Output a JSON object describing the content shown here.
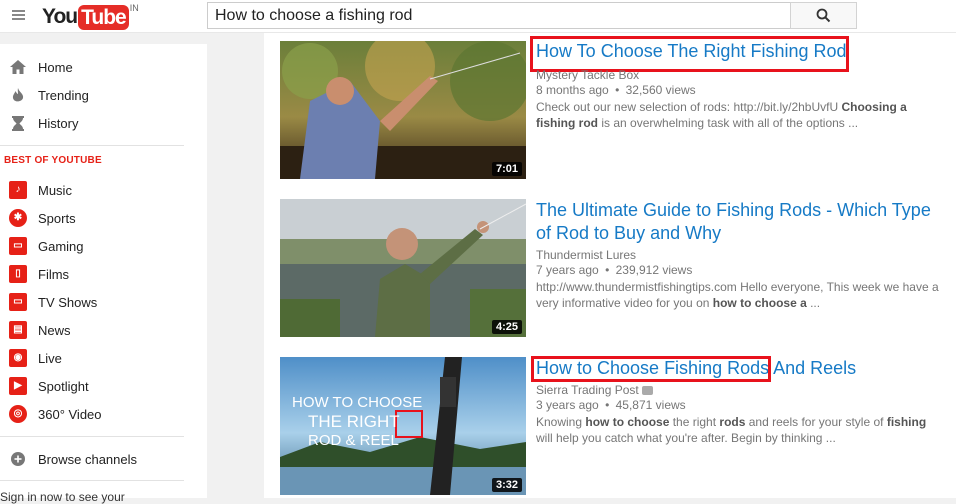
{
  "header": {
    "logo_you": "You",
    "logo_tube": "Tube",
    "logo_country": "IN",
    "search_value": "How to choose a fishing rod",
    "search_icon": "search-icon",
    "menu_icon": "hamburger-icon"
  },
  "sidebar": {
    "main_items": [
      {
        "label": "Home",
        "icon": "home-icon"
      },
      {
        "label": "Trending",
        "icon": "flame-icon"
      },
      {
        "label": "History",
        "icon": "hourglass-icon"
      }
    ],
    "best_title": "BEST OF YOUTUBE",
    "best_items": [
      {
        "label": "Music",
        "icon": "music-icon"
      },
      {
        "label": "Sports",
        "icon": "sports-icon"
      },
      {
        "label": "Gaming",
        "icon": "gaming-icon"
      },
      {
        "label": "Films",
        "icon": "film-icon"
      },
      {
        "label": "TV Shows",
        "icon": "tv-icon"
      },
      {
        "label": "News",
        "icon": "news-icon"
      },
      {
        "label": "Live",
        "icon": "live-icon"
      },
      {
        "label": "Spotlight",
        "icon": "spotlight-icon"
      },
      {
        "label": "360° Video",
        "icon": "360-video-icon"
      }
    ],
    "browse_label": "Browse channels",
    "signin_partial": "Sign in now to see your"
  },
  "results": [
    {
      "title": "How To Choose The Right Fishing Rod",
      "channel": "Mystery Tackle Box",
      "age": "8 months ago",
      "views": "32,560 views",
      "desc_plain": "Check out our new selection of rods: http://bit.ly/2hbUvfU ",
      "desc_bold": "Choosing a fishing rod",
      "desc_rest": " is an overwhelming task with all of the options ...",
      "duration": "7:01"
    },
    {
      "title_line1": "The Ultimate Guide to Fishing Rods - Which Type",
      "title_line2": "of Rod to Buy and Why",
      "channel": "Thundermist Lures",
      "age": "7 years ago",
      "views": "239,912 views",
      "desc_plain": "http://www.thundermistfishingtips.com Hello everyone, This week we have a very informative video for you on ",
      "desc_bold": "how to choose a",
      "desc_rest": " ...",
      "duration": "4:25"
    },
    {
      "title_highlight": "How to Choose Fishing Rods",
      "title_rest": " And Reels",
      "channel": "Sierra Trading Post",
      "age": "3 years ago",
      "views": "45,871 views",
      "desc_a": "Knowing ",
      "desc_b1": "how to choose",
      "desc_c": " the right ",
      "desc_b2": "rods",
      "desc_d": " and reels for your style of ",
      "desc_b3": "fishing",
      "desc_e": " will help you catch what you're after. Begin by thinking ...",
      "duration": "3:32",
      "thumb_text_1": "HOW TO CHOOSE",
      "thumb_text_2": "THE RIGHT",
      "thumb_text_3": "ROD & REEL"
    }
  ],
  "meta_separator": "•",
  "colors": {
    "youtube_red": "#e62117",
    "link_blue": "#167ac6",
    "highlight_red": "#e8121c"
  }
}
